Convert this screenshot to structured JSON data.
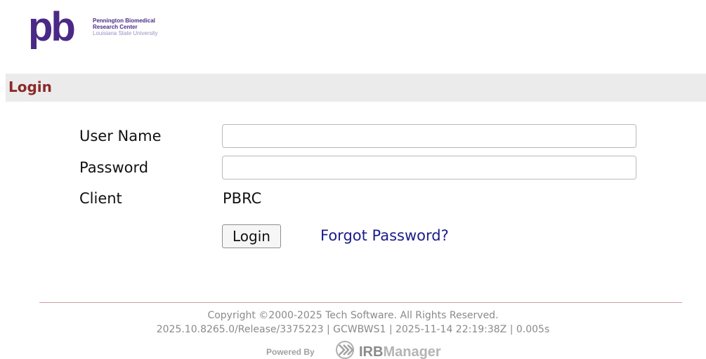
{
  "logo": {
    "mark": "pb",
    "line1": "Pennington Biomedical",
    "line2": "Research Center",
    "line3": "Louisiana State University",
    "color": "#4a2a86"
  },
  "header": {
    "title": "Login",
    "title_color": "#8b2a2a",
    "bar_color": "#ebebeb"
  },
  "form": {
    "username_label": "User Name",
    "username_value": "",
    "password_label": "Password",
    "password_value": "",
    "client_label": "Client",
    "client_value": "PBRC",
    "login_button": "Login",
    "forgot_link": "Forgot Password?",
    "link_color": "#1c1c8a"
  },
  "footer": {
    "copyright": "Copyright ©2000-2025 Tech Software. All Rights Reserved.",
    "build_info": "2025.10.8265.0/Release/3375223 | GCWBWS1 | 2025-11-14 22:19:38Z | 0.005s",
    "powered_by": "Powered By",
    "brand_strong": "IRB",
    "brand_light": "Manager",
    "brand_icon": "chevron-arrows-icon"
  }
}
